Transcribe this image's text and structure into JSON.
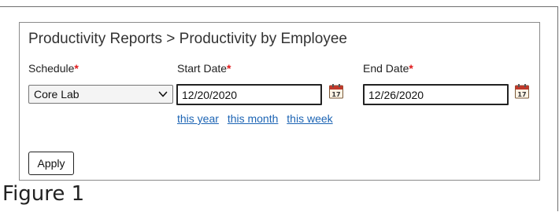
{
  "page": {
    "title": "Productivity Reports > Productivity by Employee",
    "figure_caption": "Figure 1"
  },
  "form": {
    "schedule": {
      "label": "Schedule",
      "required_mark": "*",
      "selected": "Core Lab"
    },
    "start_date": {
      "label": "Start Date",
      "required_mark": "*",
      "value": "12/20/2020"
    },
    "end_date": {
      "label": "End Date",
      "required_mark": "*",
      "value": "12/26/2020"
    },
    "quick_links": [
      "this year",
      "this month",
      "this week"
    ],
    "apply_label": "Apply"
  },
  "icons": {
    "calendar": "calendar-icon",
    "select": "chevron-down-icon"
  },
  "colors": {
    "required": "#e0191b",
    "link": "#1c64b4",
    "calendar_accent": "#c0392b"
  }
}
